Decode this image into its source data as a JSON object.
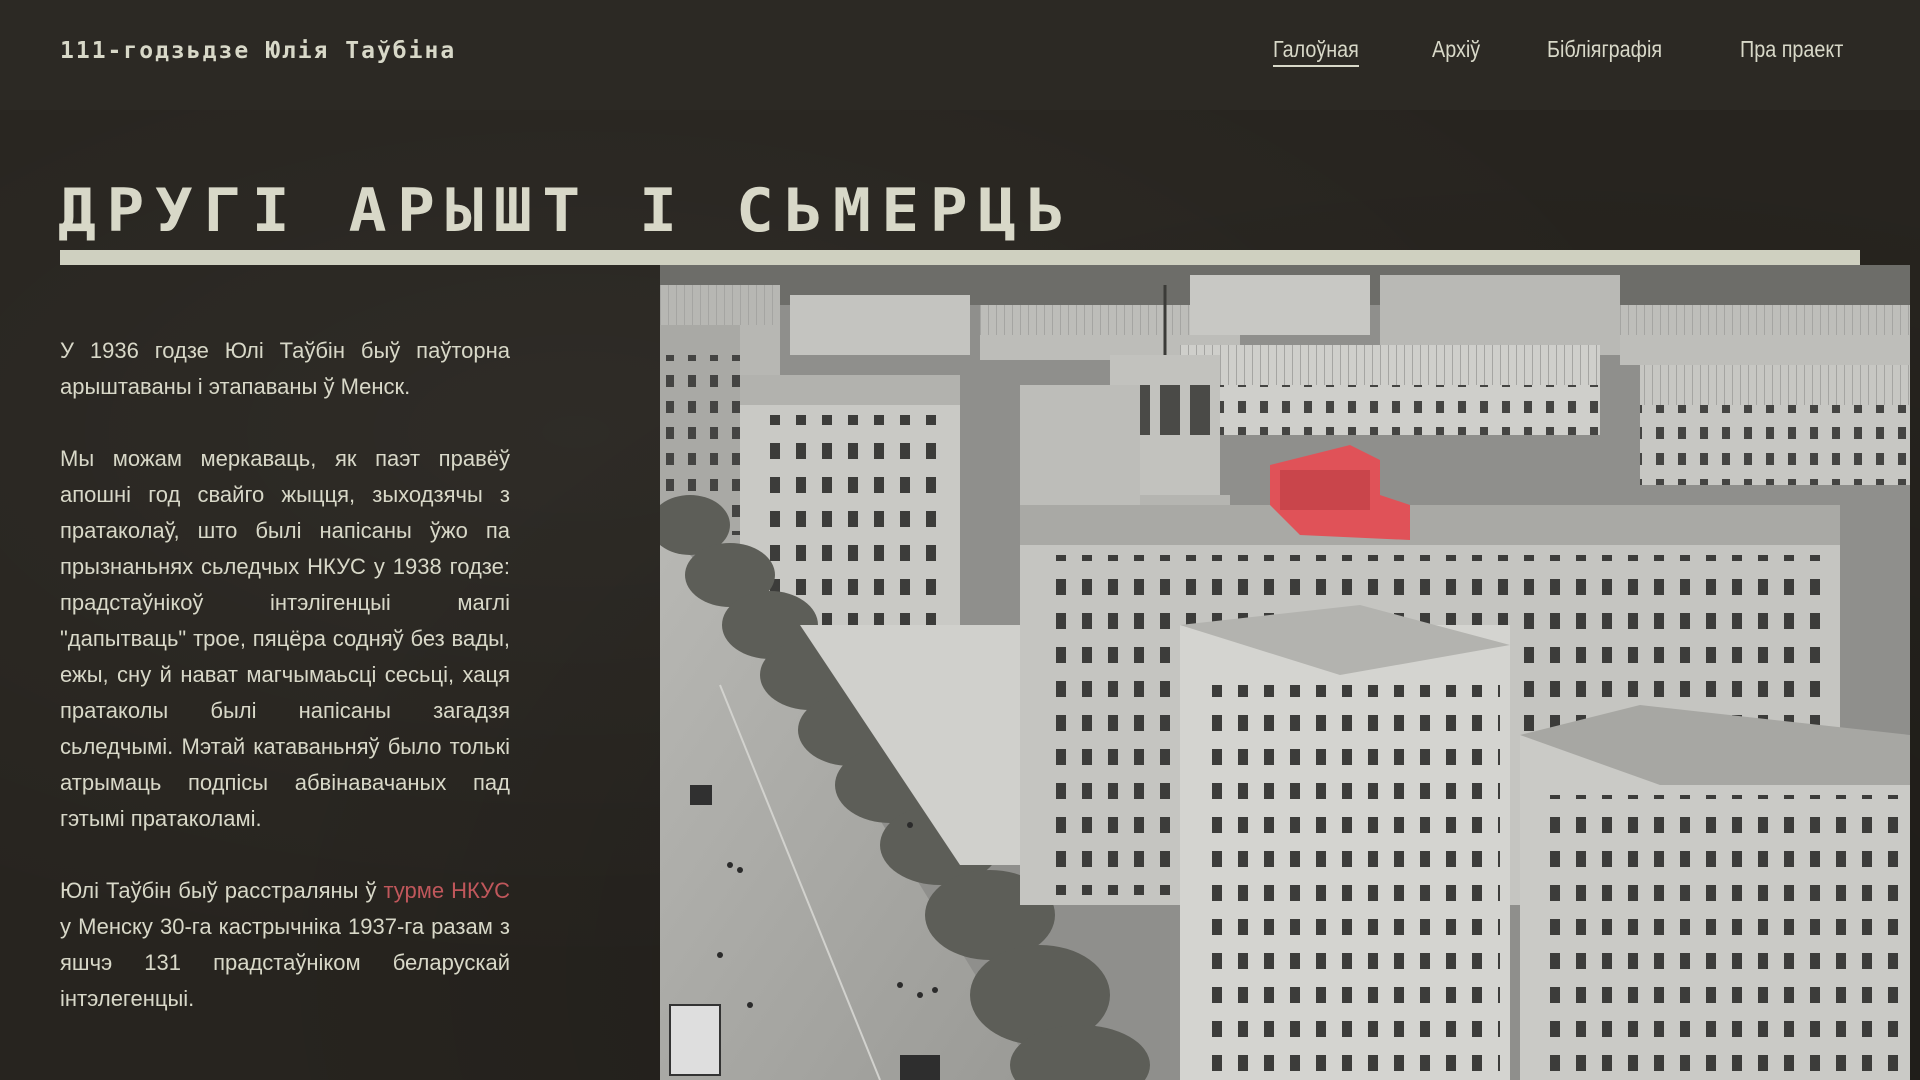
{
  "header": {
    "site_title": "111-годзьдзе Юлія Таўбіна",
    "nav": [
      {
        "label": "Галоўная",
        "active": true
      },
      {
        "label": "Архіў",
        "active": false
      },
      {
        "label": "Бібліяграфія",
        "active": false
      },
      {
        "label": "Пра праект",
        "active": false
      }
    ]
  },
  "main": {
    "title": "ДРУГІ АРЫШТ І СЬМЕРЦЬ",
    "paragraphs": [
      "У 1936 годзе Юлі Таўбін быў паўторна арыштаваны і этапаваны ў Менск.",
      "Мы можам меркаваць, як паэт правёў апошні год свайго жыцця, зыходзячы з пратаколаў, што былі напісаны ўжо па прызнаньнях сьледчых НКУС у 1938 годзе: прадстаўнікоў інтэлігенцыі маглі \"дапытваць\" трое, пяцёра содняў без вады, ежы, сну й нават магчымаьсці сесьці, хаця пратаколы былі напісаны загадзя сьледчымі. Мэтай катаваньняў было толькі атрымаць подпісы абвінавачаных пад гэтымі пратаколамі."
    ],
    "para3": {
      "before": "Юлі Таўбін быў расстраляны ў ",
      "link": "турме НКУС",
      "after": " у Менску 30-га кастрычніка 1937-га разам з яшчэ 131 прадстаўніком беларускай інтэлегенцыі."
    },
    "photo": {
      "kind": "black-and-white aerial photograph of a city street",
      "highlight_color": "#e05258"
    }
  },
  "colors": {
    "background": "#27241f",
    "header_background": "#2c2924",
    "text": "#d8d8c8",
    "accent_link": "#c0575b",
    "rule": "#cfd0c0"
  }
}
